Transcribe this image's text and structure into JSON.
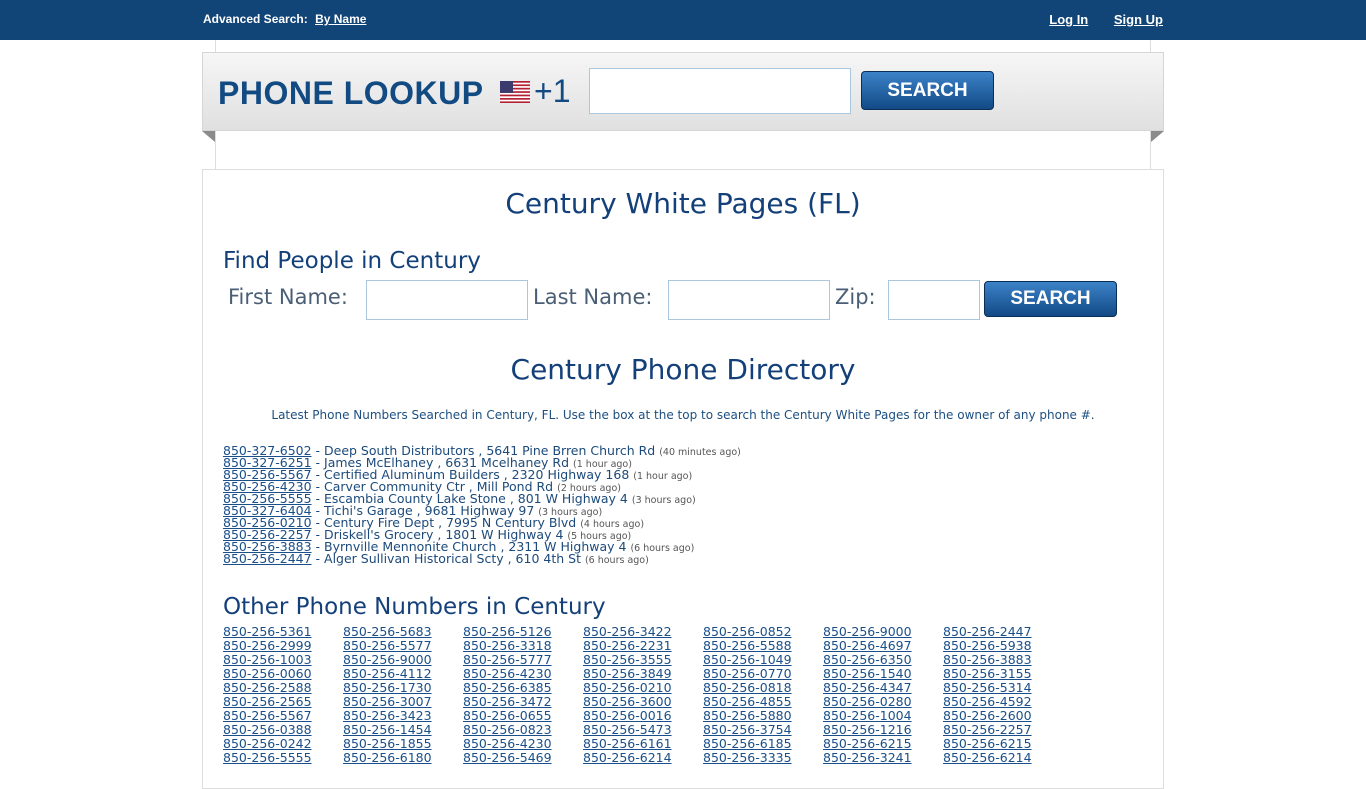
{
  "topbar": {
    "advanced_label": "Advanced Search:",
    "by_name_link": "By Name",
    "login_link": "Log In",
    "signup_link": "Sign Up"
  },
  "header": {
    "logo_text": "PHONE LOOKUP",
    "country_code": "+1",
    "phone_input_value": "",
    "search_button": "SEARCH"
  },
  "page": {
    "title": "Century White Pages (FL)",
    "find_people_heading": "Find People in Century",
    "first_name_label": "First Name:",
    "last_name_label": "Last Name:",
    "zip_label": "Zip:",
    "people_search_button": "SEARCH",
    "directory_heading": "Century Phone Directory",
    "intro_text": "Latest Phone Numbers Searched in Century, FL. Use the box at the top to search the Century White Pages for the owner of any phone #.",
    "other_heading": "Other Phone Numbers in Century"
  },
  "latest_searches": [
    {
      "number": "850-327-6502",
      "desc": "- Deep South Distributors , 5641 Pine Brren Church Rd",
      "ago": "(40 minutes ago)"
    },
    {
      "number": "850-327-6251",
      "desc": "- James McElhaney , 6631 Mcelhaney Rd",
      "ago": "(1 hour ago)"
    },
    {
      "number": "850-256-5567",
      "desc": "- Certified Aluminum Builders , 2320 Highway 168",
      "ago": "(1 hour ago)"
    },
    {
      "number": "850-256-4230",
      "desc": "- Carver Community Ctr , Mill Pond Rd",
      "ago": "(2 hours ago)"
    },
    {
      "number": "850-256-5555",
      "desc": "- Escambia County Lake Stone , 801 W Highway 4",
      "ago": "(3 hours ago)"
    },
    {
      "number": "850-327-6404",
      "desc": "- Tichi's Garage , 9681 Highway 97",
      "ago": "(3 hours ago)"
    },
    {
      "number": "850-256-0210",
      "desc": "- Century Fire Dept , 7995 N Century Blvd",
      "ago": "(4 hours ago)"
    },
    {
      "number": "850-256-2257",
      "desc": "- Driskell's Grocery , 1801 W Highway 4",
      "ago": "(5 hours ago)"
    },
    {
      "number": "850-256-3883",
      "desc": "- Byrnville Mennonite Church , 2311 W Highway 4",
      "ago": "(6 hours ago)"
    },
    {
      "number": "850-256-2447",
      "desc": "- Alger Sullivan Historical Scty , 610 4th St",
      "ago": "(6 hours ago)"
    }
  ],
  "other_numbers": [
    [
      "850-256-5361",
      "850-256-2999",
      "850-256-1003",
      "850-256-0060",
      "850-256-2588",
      "850-256-2565",
      "850-256-5567",
      "850-256-0388",
      "850-256-0242",
      "850-256-5555"
    ],
    [
      "850-256-5683",
      "850-256-5577",
      "850-256-9000",
      "850-256-4112",
      "850-256-1730",
      "850-256-3007",
      "850-256-3423",
      "850-256-1454",
      "850-256-1855",
      "850-256-6180"
    ],
    [
      "850-256-5126",
      "850-256-3318",
      "850-256-5777",
      "850-256-4230",
      "850-256-6385",
      "850-256-3472",
      "850-256-0655",
      "850-256-0823",
      "850-256-4230",
      "850-256-5469"
    ],
    [
      "850-256-3422",
      "850-256-2231",
      "850-256-3555",
      "850-256-3849",
      "850-256-0210",
      "850-256-3600",
      "850-256-0016",
      "850-256-5473",
      "850-256-6161",
      "850-256-6214"
    ],
    [
      "850-256-0852",
      "850-256-5588",
      "850-256-1049",
      "850-256-0770",
      "850-256-0818",
      "850-256-4855",
      "850-256-5880",
      "850-256-3754",
      "850-256-6185",
      "850-256-3335"
    ],
    [
      "850-256-9000",
      "850-256-4697",
      "850-256-6350",
      "850-256-1540",
      "850-256-4347",
      "850-256-0280",
      "850-256-1004",
      "850-256-1216",
      "850-256-6215",
      "850-256-3241"
    ],
    [
      "850-256-2447",
      "850-256-5938",
      "850-256-3883",
      "850-256-3155",
      "850-256-5314",
      "850-256-4592",
      "850-256-2600",
      "850-256-2257",
      "850-256-6215",
      "850-256-6214"
    ]
  ]
}
